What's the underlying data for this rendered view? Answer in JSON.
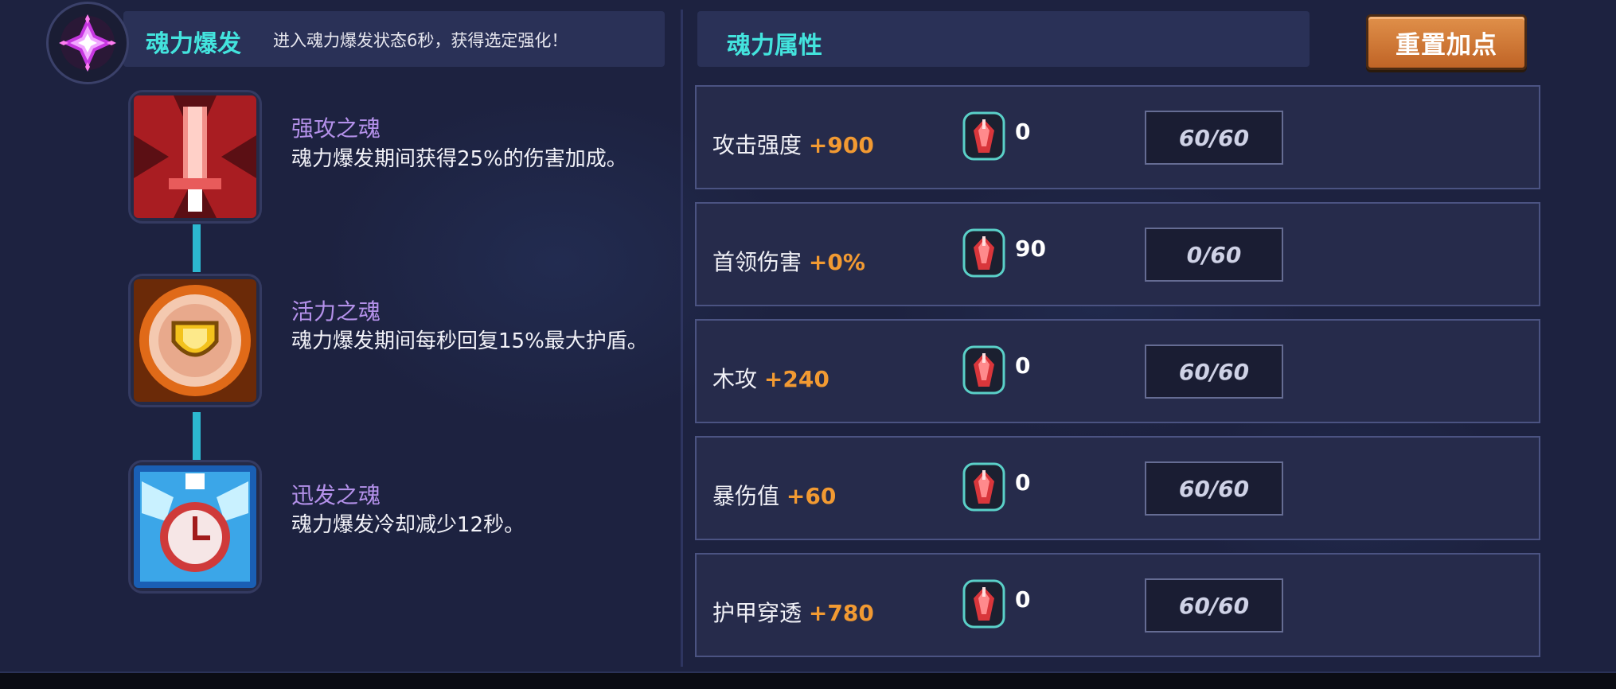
{
  "burst": {
    "title": "魂力爆发",
    "description": "进入魂力爆发状态6秒，获得选定强化！"
  },
  "skills": [
    {
      "name": "强攻之魂",
      "description": "魂力爆发期间获得25%的伤害加成。"
    },
    {
      "name": "活力之魂",
      "description": "魂力爆发期间每秒回复15%最大护盾。"
    },
    {
      "name": "迅发之魂",
      "description": "魂力爆发冷却减少12秒。"
    }
  ],
  "attributes": {
    "title": "魂力属性",
    "reset_label": "重置加点",
    "rows": [
      {
        "name": "攻击强度",
        "bonus": "+900",
        "gems": "0",
        "level": "60/60"
      },
      {
        "name": "首领伤害",
        "bonus": "+0%",
        "gems": "90",
        "level": "0/60"
      },
      {
        "name": "木攻",
        "bonus": "+240",
        "gems": "0",
        "level": "60/60"
      },
      {
        "name": "暴伤值",
        "bonus": "+60",
        "gems": "0",
        "level": "60/60"
      },
      {
        "name": "护甲穿透",
        "bonus": "+780",
        "gems": "0",
        "level": "60/60"
      }
    ]
  },
  "colors": {
    "accent_cyan": "#43e3dd",
    "skill_name_purple": "#b491ea",
    "bonus_orange": "#f29a32",
    "button_orange": "#d97f3c"
  },
  "icons": {
    "burst": "purple-crystal-icon",
    "skill_1": "red-sword-icon",
    "skill_2": "gold-shield-icon",
    "skill_3": "blue-clock-icon",
    "gem": "soul-gem-icon"
  }
}
